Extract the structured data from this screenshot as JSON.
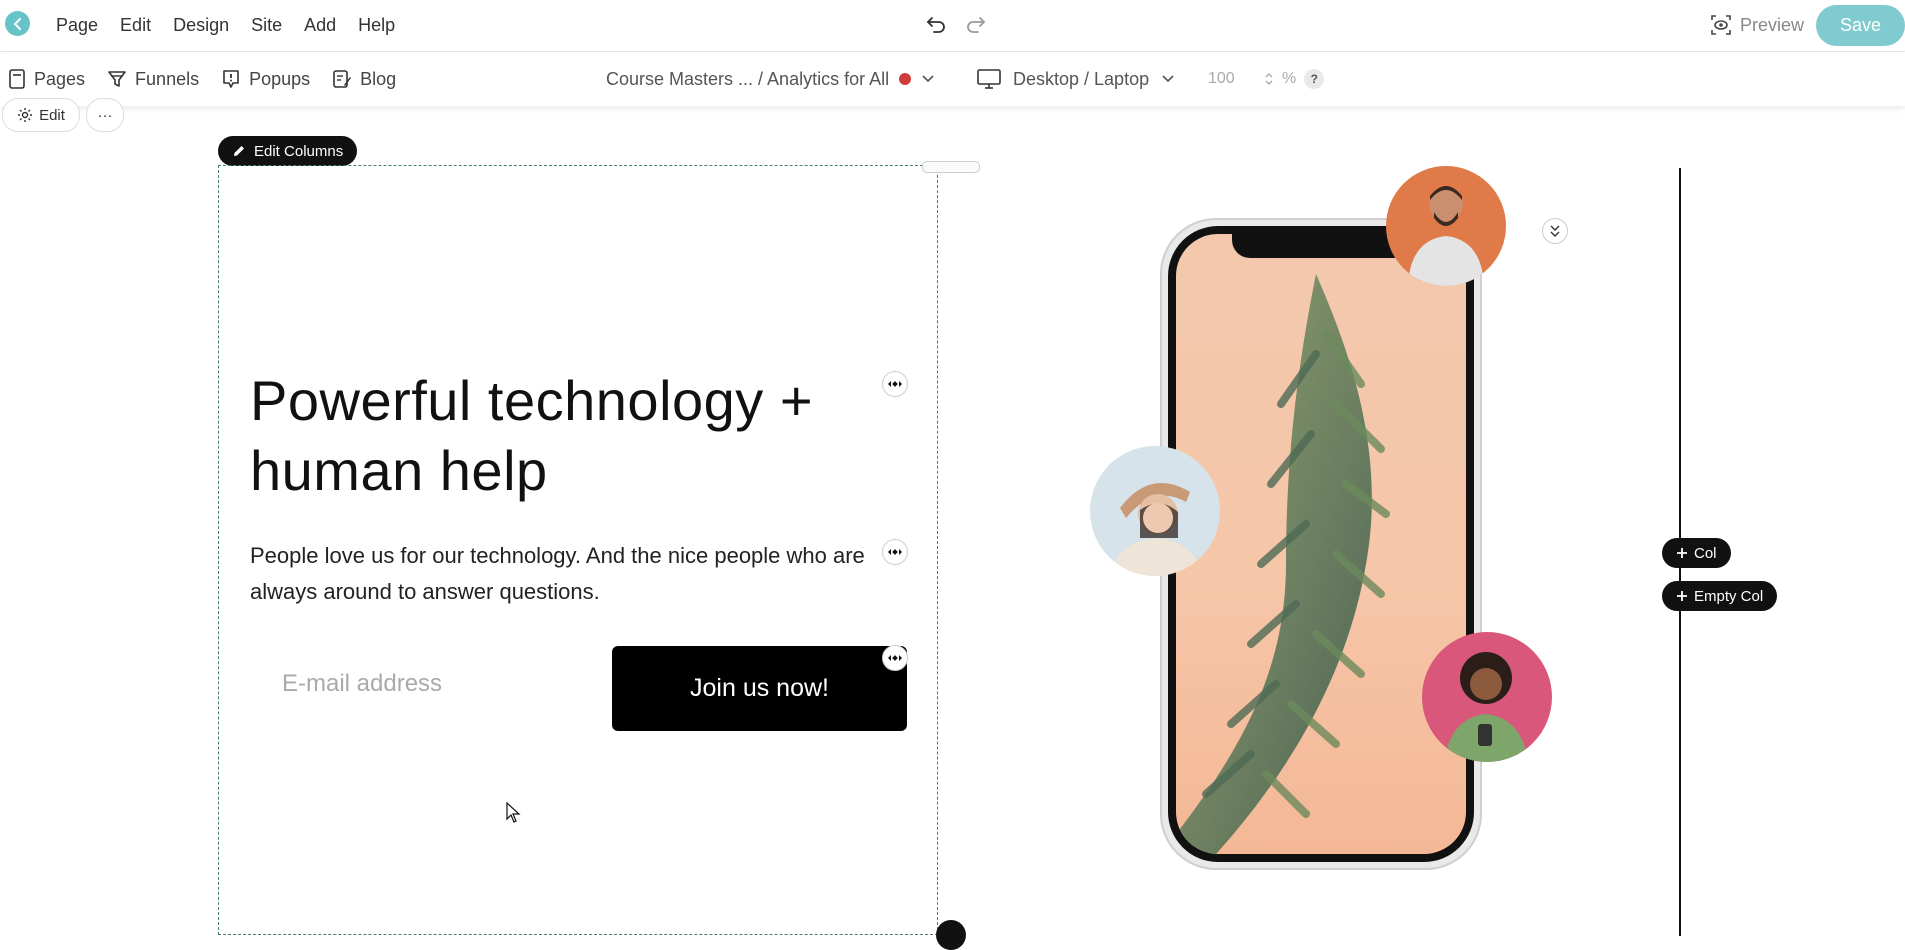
{
  "menu": {
    "items": [
      "Page",
      "Edit",
      "Design",
      "Site",
      "Add",
      "Help"
    ],
    "preview_label": "Preview",
    "save_label": "Save"
  },
  "toolbar": {
    "tabs": [
      {
        "label": "Pages",
        "icon": "page-icon"
      },
      {
        "label": "Funnels",
        "icon": "funnel-icon"
      },
      {
        "label": "Popups",
        "icon": "popup-icon"
      },
      {
        "label": "Blog",
        "icon": "blog-icon"
      }
    ],
    "breadcrumb": "Course Masters ... / Analytics for All",
    "device": "Desktop / Laptop",
    "zoom": "100",
    "zoom_unit": "%",
    "help": "?"
  },
  "canvas": {
    "edit_label": "Edit",
    "more_label": "···",
    "edit_columns_label": "Edit Columns",
    "headline": "Powerful technology + human help",
    "subtext": "People love us for our technology. And the nice people who are always around to answer questions.",
    "email_placeholder": "E-mail address",
    "cta_label": "Join us now!",
    "add_col_label": "Col",
    "add_empty_col_label": "Empty Col"
  },
  "colors": {
    "accent": "#66c3c8",
    "save": "#7fcbcf",
    "status_dot": "#d23b3b"
  }
}
